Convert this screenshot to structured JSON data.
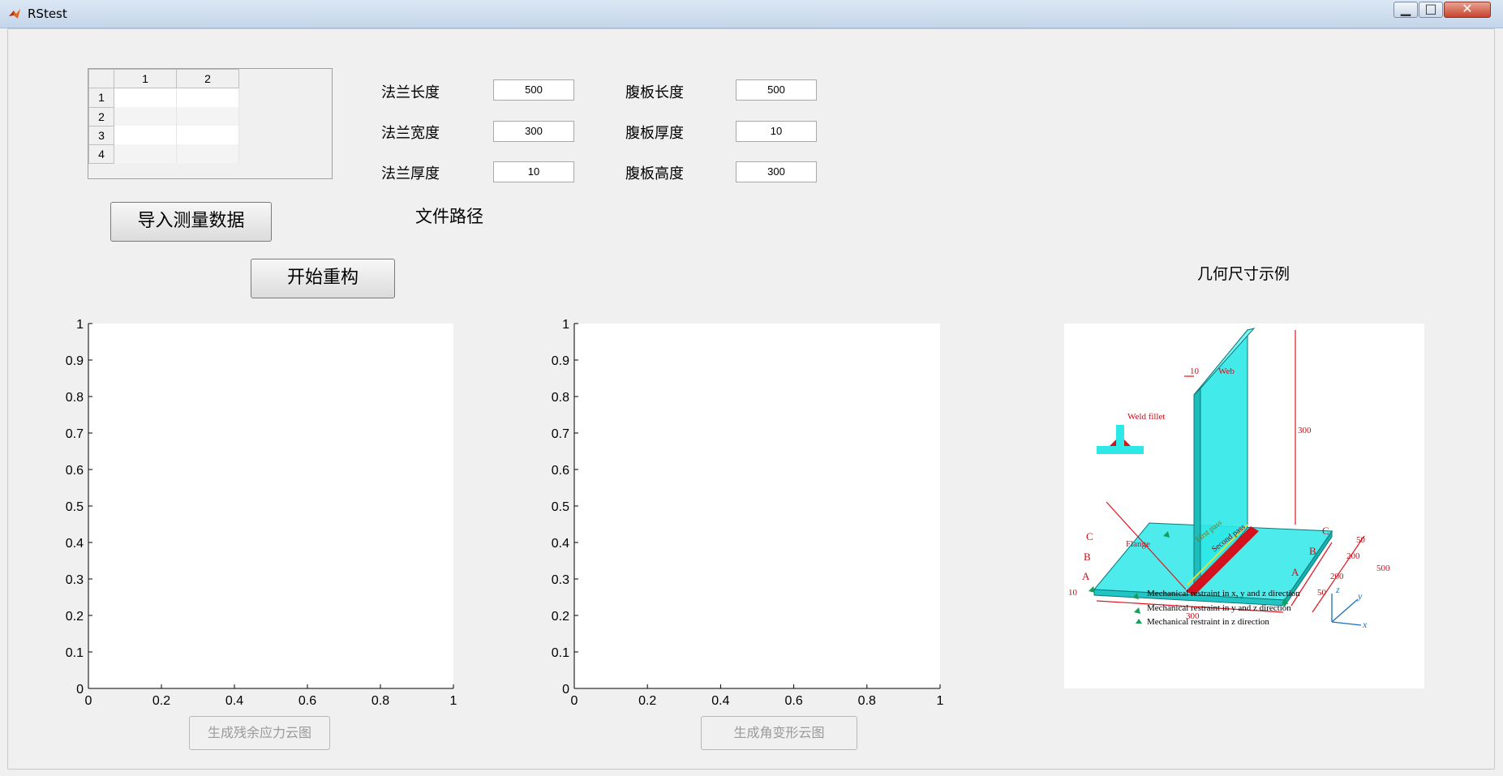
{
  "window": {
    "title": "RStest"
  },
  "table": {
    "columns": [
      "1",
      "2"
    ],
    "rows": [
      "1",
      "2",
      "3",
      "4"
    ]
  },
  "params": {
    "flange_length_label": "法兰长度",
    "flange_length_value": "500",
    "flange_width_label": "法兰宽度",
    "flange_width_value": "300",
    "flange_thickness_label": "法兰厚度",
    "flange_thickness_value": "10",
    "web_length_label": "腹板长度",
    "web_length_value": "500",
    "web_thickness_label": "腹板厚度",
    "web_thickness_value": "10",
    "web_height_label": "腹板高度",
    "web_height_value": "300"
  },
  "buttons": {
    "import_label": "导入测量数据",
    "reconstruct_label": "开始重构",
    "stress_label": "生成残余应力云图",
    "deform_label": "生成角变形云图"
  },
  "file_path_label": "文件路径",
  "example_title": "几何尺寸示例",
  "axes_ticks": {
    "y": [
      "0",
      "0.1",
      "0.2",
      "0.3",
      "0.4",
      "0.5",
      "0.6",
      "0.7",
      "0.8",
      "0.9",
      "1"
    ],
    "x": [
      "0",
      "0.2",
      "0.4",
      "0.6",
      "0.8",
      "1"
    ]
  },
  "diagram": {
    "web": "Web",
    "weld_fillet": "Weld fillet",
    "flange": "Flange",
    "first_pass": "First pass",
    "second_pass": "Second pass",
    "dim_10_top": "10",
    "dim_300_height": "300",
    "dim_10_side": "10",
    "dim_300_width": "300",
    "dim_50a": "50",
    "dim_200a": "200",
    "dim_200b": "200",
    "dim_50b": "50",
    "dim_500": "500",
    "label_a_left": "A",
    "label_b_left": "B",
    "label_c_left": "C",
    "label_a_right": "A",
    "label_b_right": "B",
    "label_c_right": "C",
    "legend_1": "Mechanical restraint in x, y and z direction",
    "legend_2": "Mechanical restraint in y and z direction",
    "legend_3": "Mechanical restraint in z direction",
    "axis_x": "x",
    "axis_y": "y",
    "axis_z": "z"
  },
  "colors": {
    "steel": "#2ee8e8",
    "weld": "#d4121e",
    "dim": "#e0141e",
    "restraint": "#14a05a",
    "axis": "#1a6fc0"
  }
}
